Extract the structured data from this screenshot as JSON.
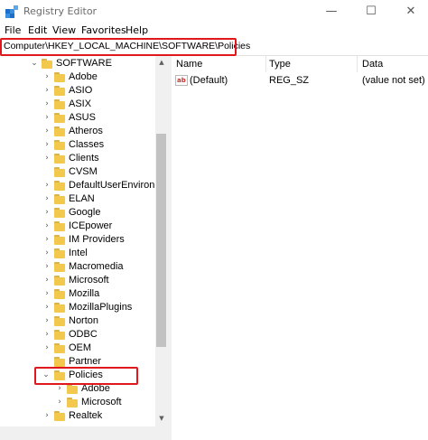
{
  "window": {
    "title": "Registry Editor",
    "minimize_glyph": "—",
    "maximize_glyph": "☐",
    "close_glyph": "✕"
  },
  "menu": [
    "File",
    "Edit",
    "View",
    "Favorites",
    "Help"
  ],
  "address": {
    "path": "Computer\\HKEY_LOCAL_MACHINE\\SOFTWARE\\Policies"
  },
  "tree": {
    "root": "SOFTWARE",
    "items": [
      "Adobe",
      "ASIO",
      "ASIX",
      "ASUS",
      "Atheros",
      "Classes",
      "Clients",
      "CVSM",
      "DefaultUserEnvironm",
      "ELAN",
      "Google",
      "ICEpower",
      "IM Providers",
      "Intel",
      "Macromedia",
      "Microsoft",
      "Mozilla",
      "MozillaPlugins",
      "Norton",
      "ODBC",
      "OEM",
      "Partner",
      "Policies"
    ],
    "policies_children": [
      "Adobe",
      "Microsoft"
    ],
    "after": [
      "Realtek"
    ]
  },
  "list": {
    "columns": {
      "name": "Name",
      "type": "Type",
      "data": "Data"
    },
    "rows": [
      {
        "name": "(Default)",
        "type": "REG_SZ",
        "data": "(value not set)",
        "icon": "ab-string-icon"
      }
    ]
  },
  "colors": {
    "highlight": "#e0181b",
    "folder": "#f2c94c"
  }
}
